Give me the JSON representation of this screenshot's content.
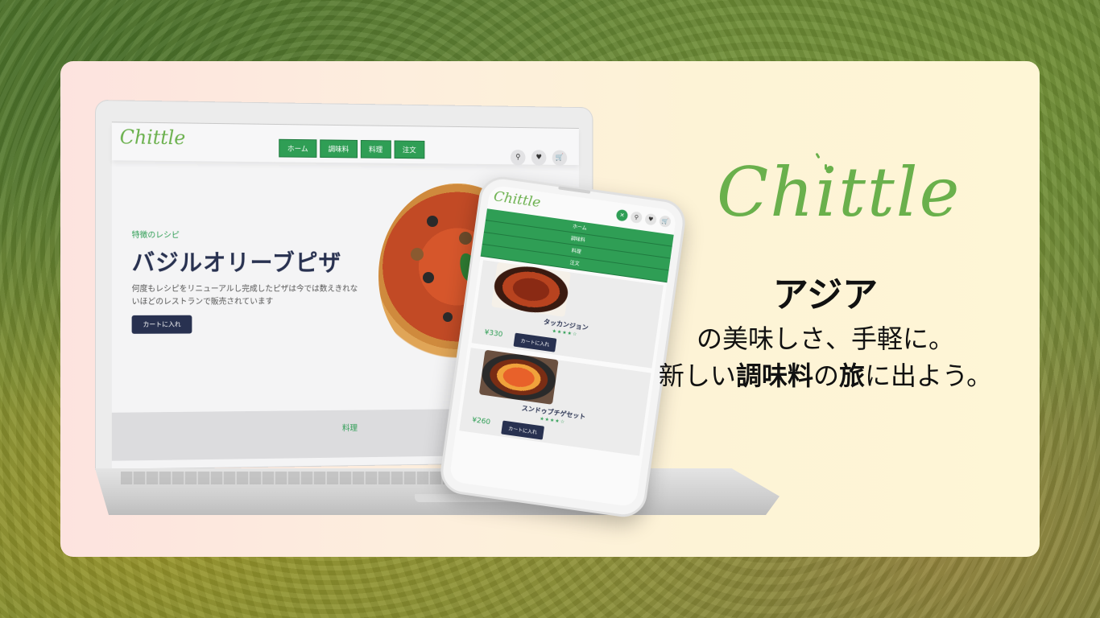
{
  "brand": {
    "logo": "Chittle"
  },
  "laptop": {
    "nav": [
      "ホーム",
      "調味料",
      "料理",
      "注文"
    ],
    "hero": {
      "kicker": "特徴のレシピ",
      "title": "バジルオリーブピザ",
      "description": "何度もレシピをリニューアルし完成したピザは今では数えきれないほどのレストランで販売されています",
      "cta": "カートに入れ"
    },
    "section_label": "料理"
  },
  "phone": {
    "nav": [
      "ホーム",
      "調味料",
      "料理",
      "注文"
    ],
    "products": [
      {
        "name": "タッカンジョン",
        "price": "¥330",
        "cta": "カートに入れ",
        "rating": 4.5
      },
      {
        "name": "スンドゥブチゲセット",
        "price": "¥260",
        "cta": "カートに入れ",
        "rating": 4.5
      }
    ]
  },
  "tagline": {
    "headline": "アジア",
    "line1": "の美味しさ、手軽に。",
    "line2_a": "新しい",
    "line2_b": "調味料",
    "line2_c": "の",
    "line2_d": "旅",
    "line2_e": "に出よう。"
  },
  "colors": {
    "accent_green": "#2f9e55",
    "logo_green": "#6ab04c",
    "navy": "#283150"
  }
}
